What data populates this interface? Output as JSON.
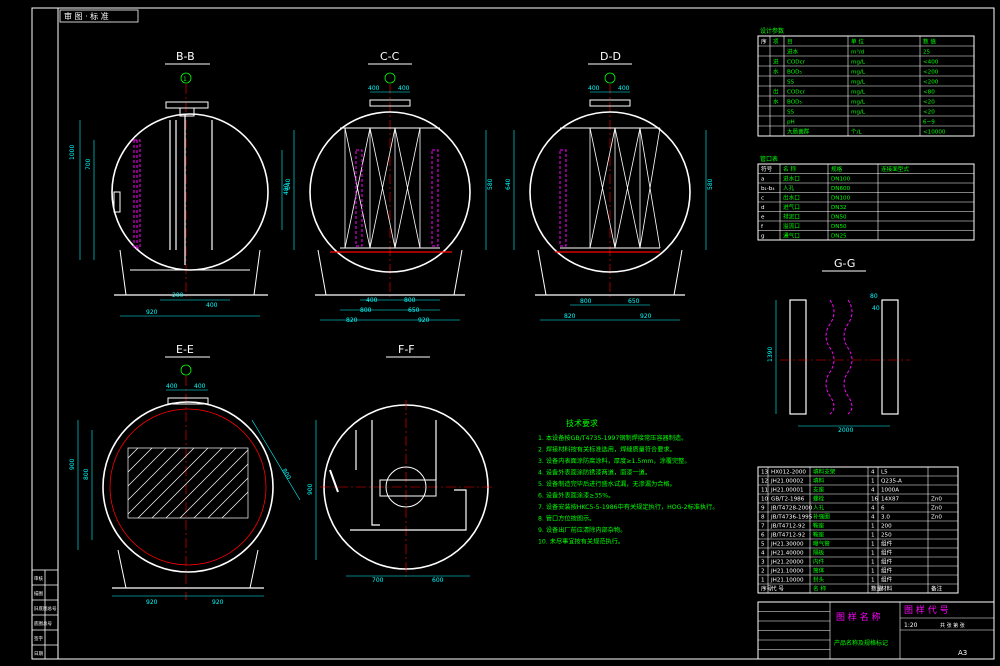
{
  "title_tag": "审 图 · 标 准",
  "views": {
    "bb": "B-B",
    "cc": "C-C",
    "dd": "D-D",
    "ee": "E-E",
    "ff": "F-F",
    "gg": "G-G"
  },
  "dims": {
    "bb_h1": "1000",
    "bb_h2": "700",
    "bb_r": "480",
    "bb_b1": "200",
    "bb_b2": "400",
    "bb_w": "920",
    "cc_t1": "400",
    "cc_t2": "400",
    "cc_l": "640",
    "cc_r": "580",
    "cc_b1": "400",
    "cc_b2": "800",
    "cc_b3": "800",
    "cc_b4": "650",
    "cc_w1": "820",
    "cc_w2": "920",
    "dd_t1": "400",
    "dd_t2": "400",
    "dd_l": "640",
    "dd_r": "580",
    "dd_b1": "800",
    "dd_b2": "650",
    "dd_w1": "820",
    "dd_w2": "920",
    "ee_t1": "400",
    "ee_t2": "400",
    "ee_l1": "900",
    "ee_l2": "800",
    "ee_diag": "800",
    "ee_w1": "920",
    "ee_w2": "920",
    "ff_l": "900",
    "ff_w1": "700",
    "ff_w2": "600",
    "gg_h": "1390",
    "gg_t1": "80",
    "gg_t2": "40",
    "gg_w": "2000"
  },
  "notes": {
    "title": "技术要求",
    "lines": [
      "1. 本设备按GB/T4735-1997钢制焊接常压容器制造。",
      "2. 焊接材料按有关标准选用，焊缝质量符合要求。",
      "3. 设备内表面涂防腐涂料，厚度≥1.5mm，涂覆完整。",
      "4. 设备外表面涂防锈漆两道，面漆一道。",
      "5. 设备制造完毕后进行盛水试漏，无渗漏为合格。",
      "6. 设备外表面涂漆≥35%。",
      "7. 设备安装按HKC5-5-1986中有关规定执行，HOG-2标准执行。",
      "8. 管口方位按图示。",
      "9. 设备出厂前应清除内部杂物。",
      "10. 未尽事宜按有关规范执行。"
    ]
  },
  "quality_table": {
    "title": "设计参数",
    "headers": [
      "序",
      "项",
      "目",
      "单 位",
      "数 值"
    ],
    "rows": [
      [
        "",
        "",
        "进水",
        "m³/d",
        "25"
      ],
      [
        "",
        "进",
        "CODcr",
        "mg/L",
        "<400"
      ],
      [
        "",
        "水",
        "BOD₅",
        "mg/L",
        "<200"
      ],
      [
        "",
        "",
        "SS",
        "mg/L",
        "<200"
      ],
      [
        "",
        "出",
        "CODcr",
        "mg/L",
        "<80"
      ],
      [
        "",
        "水",
        "BOD₅",
        "mg/L",
        "<20"
      ],
      [
        "",
        "",
        "SS",
        "mg/L",
        "<20"
      ],
      [
        "",
        "",
        "pH",
        "",
        "6~9"
      ],
      [
        "",
        "",
        "大肠菌群",
        "个/L",
        "<10000"
      ]
    ]
  },
  "nozzle_table": {
    "title": "管口表",
    "headers": [
      "符号",
      "名 称",
      "规格",
      "连接面型式"
    ],
    "rows": [
      [
        "a",
        "进水口",
        "DN100",
        ""
      ],
      [
        "b₁-b₄",
        "人孔",
        "DN600",
        ""
      ],
      [
        "c",
        "出水口",
        "DN100",
        ""
      ],
      [
        "d",
        "进气口",
        "DN32",
        ""
      ],
      [
        "e",
        "排泥口",
        "DN50",
        ""
      ],
      [
        "f",
        "溢流口",
        "DN50",
        ""
      ],
      [
        "g",
        "通气口",
        "DN25",
        ""
      ]
    ]
  },
  "parts_table": {
    "rows": [
      [
        "13",
        "HX012-2000",
        "填料支架",
        "4",
        "L5",
        ""
      ],
      [
        "12",
        "JH21.00002",
        "填料",
        "1",
        "Q235-A",
        ""
      ],
      [
        "11",
        "JH21.00001",
        "支座",
        "4",
        "1000A",
        ""
      ],
      [
        "10",
        "GB/T2-1986",
        "螺栓",
        "16",
        "14X87",
        "Zn0"
      ],
      [
        "9",
        "JB/T4728-2000",
        "人孔",
        "4",
        "6",
        "Zn0"
      ],
      [
        "8",
        "JB/T4736-1995",
        "补强圈",
        "4",
        "3.0",
        "Zn0"
      ],
      [
        "7",
        "JB/T4712-92",
        "鞍座",
        "1",
        "200",
        ""
      ],
      [
        "6",
        "JB/T4712-92",
        "鞍座",
        "1",
        "250",
        ""
      ],
      [
        "5",
        "JH21.30000",
        "曝气管",
        "1",
        "组件",
        ""
      ],
      [
        "4",
        "JH21.40000",
        "隔板",
        "1",
        "组件",
        ""
      ],
      [
        "3",
        "JH21.20000",
        "内件",
        "1",
        "组件",
        ""
      ],
      [
        "2",
        "JH21.10000",
        "筒体",
        "1",
        "组件",
        ""
      ],
      [
        "1",
        "JH21.10000",
        "封头",
        "1",
        "组件",
        ""
      ]
    ],
    "header": [
      "序号",
      "代 号",
      "名 称",
      "数量",
      "材料",
      "备注"
    ]
  },
  "title_block": {
    "drawing_name": "图 样 名 称",
    "drawing_code": "图 样 代 号",
    "product": "产品名称及规格标记",
    "scale": "1:20",
    "sheet": "共 张 第 张"
  },
  "left_strip": [
    "审核",
    "描图",
    "旧底图总号",
    "底图总号",
    "签字",
    "日期"
  ],
  "corner_mark": "A3"
}
